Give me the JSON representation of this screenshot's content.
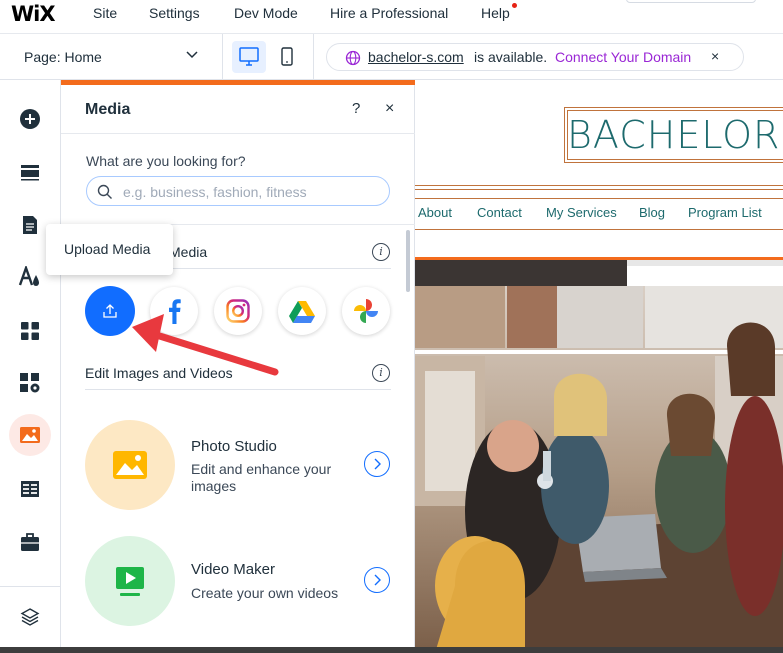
{
  "topbar": {
    "logo": "WiX",
    "menu": [
      "Site",
      "Settings",
      "Dev Mode",
      "Hire a Professional",
      "Help"
    ]
  },
  "secbar": {
    "page_label": "Page: Home",
    "domain": "bachelor-s.com",
    "available_text": "is available.",
    "connect_label": "Connect Your Domain",
    "close_label": "×"
  },
  "sidebar": {
    "items": [
      "add-elements",
      "sections",
      "pages",
      "site-design",
      "apps",
      "business-apps",
      "media",
      "cms",
      "portfolio",
      "layers"
    ],
    "active": "media",
    "accent": "#f36b1c"
  },
  "panel": {
    "title": "Media",
    "help_label": "?",
    "close_label": "×",
    "search_label": "What are you looking for?",
    "search_placeholder": "e.g. business, fashion, fitness",
    "section_add": "Media",
    "section_edit": "Edit Images and Videos",
    "tooltip": "Upload Media",
    "sources": [
      "upload-icon",
      "facebook-icon",
      "instagram-icon",
      "google-drive-icon",
      "google-photos-icon"
    ],
    "tools": [
      {
        "name": "Photo Studio",
        "desc": "Edit and enhance your images"
      },
      {
        "name": "Video Maker",
        "desc": "Create your own videos"
      }
    ]
  },
  "preview": {
    "site_title": "BACHELOR'",
    "nav": [
      "About",
      "Contact",
      "My Services",
      "Blog",
      "Program List"
    ],
    "text_color": "#1d6a6d",
    "frame_color": "#c0733c"
  },
  "colors": {
    "primary": "#116dff",
    "connect": "#9a27d5",
    "annotation_arrow": "#e8393e"
  }
}
